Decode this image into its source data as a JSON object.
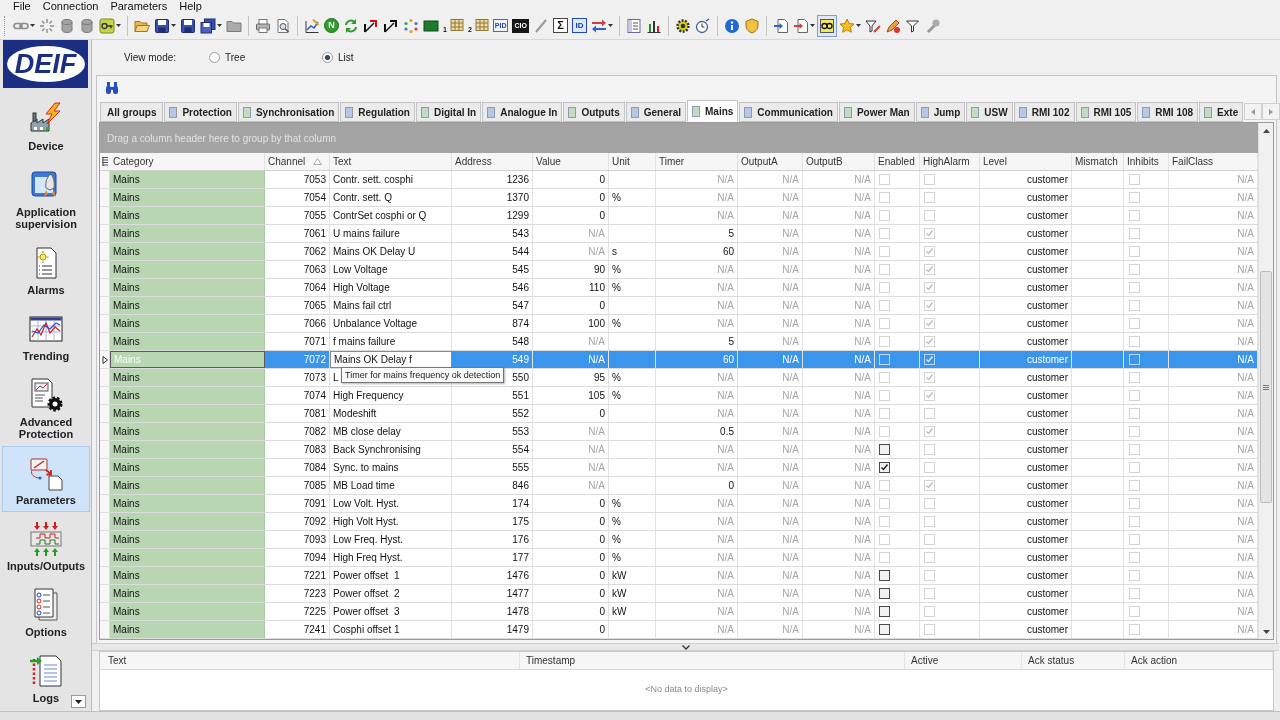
{
  "menu": [
    "File",
    "Connection",
    "Parameters",
    "Help"
  ],
  "toolbar": [
    {
      "pressed": false
    },
    {
      "pressed": false
    },
    {
      "pressed": false
    },
    {
      "pressed": false
    },
    {
      "pressed": false
    },
    {
      "pressed": false
    },
    {
      "pressed": false
    },
    {
      "pressed": false
    },
    {
      "pressed": false
    },
    {
      "pressed": false
    },
    {
      "pressed": false
    },
    {
      "pressed": false
    },
    {
      "pressed": false
    },
    {
      "pressed": false,
      "label": "N"
    },
    {
      "pressed": false
    },
    {
      "pressed": false
    },
    {
      "pressed": false
    },
    {
      "pressed": false
    },
    {
      "pressed": false
    },
    {
      "pressed": false,
      "label": "1"
    },
    {
      "pressed": false,
      "label": "2"
    },
    {
      "pressed": false,
      "label": "PID"
    },
    {
      "pressed": false,
      "label": "CIO"
    },
    {
      "pressed": false
    },
    {
      "pressed": false,
      "label": "Σ"
    },
    {
      "pressed": false,
      "label": "ID"
    },
    {
      "pressed": false
    },
    {
      "pressed": false
    },
    {
      "pressed": false
    },
    {
      "pressed": false
    },
    {
      "pressed": false
    },
    {
      "pressed": false
    },
    {
      "pressed": false
    },
    {
      "pressed": false
    },
    {
      "pressed": false
    },
    {
      "pressed": true
    },
    {
      "pressed": false
    },
    {
      "pressed": false
    },
    {
      "pressed": false
    },
    {
      "pressed": false
    },
    {
      "pressed": false
    }
  ],
  "logo": "DEIF",
  "sidebar": {
    "items": [
      {
        "label": "Device",
        "selected": false
      },
      {
        "label": "Application supervision",
        "selected": false
      },
      {
        "label": "Alarms",
        "selected": false
      },
      {
        "label": "Trending",
        "selected": false
      },
      {
        "label": "Advanced Protection",
        "selected": false
      },
      {
        "label": "Parameters",
        "selected": true
      },
      {
        "label": "Inputs/Outputs",
        "selected": false
      },
      {
        "label": "Options",
        "selected": false
      },
      {
        "label": "Logs",
        "selected": false
      }
    ]
  },
  "view_mode": {
    "label": "View mode:",
    "options": [
      {
        "label": "Tree",
        "selected": false
      },
      {
        "label": "List",
        "selected": true
      }
    ]
  },
  "tabs": [
    {
      "label": "All groups",
      "selected": false
    },
    {
      "label": "Protection",
      "selected": false,
      "color": "#b7c8e6"
    },
    {
      "label": "Synchronisation",
      "selected": false,
      "color": "#c3dbbf"
    },
    {
      "label": "Regulation",
      "selected": false,
      "color": "#b7c8e6"
    },
    {
      "label": "Digital In",
      "selected": false,
      "color": "#c3dbbf"
    },
    {
      "label": "Analogue In",
      "selected": false,
      "color": "#b7c8e6"
    },
    {
      "label": "Outputs",
      "selected": false,
      "color": "#c3dbbf"
    },
    {
      "label": "General",
      "selected": false,
      "color": "#b7c8e6"
    },
    {
      "label": "Mains",
      "selected": true,
      "color": "#c3dbbf"
    },
    {
      "label": "Communication",
      "selected": false,
      "color": "#b7c8e6"
    },
    {
      "label": "Power Man",
      "selected": false,
      "color": "#c3dbbf"
    },
    {
      "label": "Jump",
      "selected": false,
      "color": "#b7c8e6"
    },
    {
      "label": "USW",
      "selected": false,
      "color": "#c3dbbf"
    },
    {
      "label": "RMI 102",
      "selected": false,
      "color": "#b7c8e6"
    },
    {
      "label": "RMI 105",
      "selected": false,
      "color": "#c3dbbf"
    },
    {
      "label": "RMI 108",
      "selected": false,
      "color": "#b7c8e6"
    },
    {
      "label": "Exte",
      "selected": false,
      "color": "#c3dbbf"
    }
  ],
  "table": {
    "group_by_hint": "Drag a column header here to group by that column",
    "columns": [
      {
        "label": "Category",
        "sorted": false
      },
      {
        "label": "Channel",
        "sorted": true
      },
      {
        "label": "Text",
        "sorted": false
      },
      {
        "label": "Address",
        "sorted": false
      },
      {
        "label": "Value",
        "sorted": false
      },
      {
        "label": "Unit",
        "sorted": false
      },
      {
        "label": "Timer",
        "sorted": false
      },
      {
        "label": "OutputA",
        "sorted": false
      },
      {
        "label": "OutputB",
        "sorted": false
      },
      {
        "label": "Enabled",
        "sorted": false
      },
      {
        "label": "HighAlarm",
        "sorted": false
      },
      {
        "label": "Level",
        "sorted": false
      },
      {
        "label": "Mismatch",
        "sorted": false
      },
      {
        "label": "Inhibits",
        "sorted": false
      },
      {
        "label": "FailClass",
        "sorted": false
      }
    ],
    "rows": [
      {
        "selected": false,
        "category": "Mains",
        "channel": "7053",
        "text": "Contr. sett. cosphi",
        "address": "1236",
        "value": "0",
        "value_dimmed": false,
        "timer": "N/A",
        "timer_dimmed": true,
        "output_a": "N/A",
        "output_b": "N/A",
        "enabled": {
          "checked": false,
          "disabled": true
        },
        "high_alarm": false,
        "access_level": "customer",
        "inhibits": false,
        "fail_class": "N/A"
      },
      {
        "selected": false,
        "category": "Mains",
        "channel": "7054",
        "text": "Contr. sett. Q",
        "address": "1370",
        "value": "0",
        "value_dimmed": false,
        "unit": "%",
        "timer": "N/A",
        "timer_dimmed": true,
        "output_a": "N/A",
        "output_b": "N/A",
        "enabled": {
          "checked": false,
          "disabled": true
        },
        "high_alarm": false,
        "access_level": "customer",
        "inhibits": false,
        "fail_class": "N/A"
      },
      {
        "selected": false,
        "category": "Mains",
        "channel": "7055",
        "text": "ContrSet cosphi or Q",
        "address": "1299",
        "value": "0",
        "value_dimmed": false,
        "timer": "N/A",
        "timer_dimmed": true,
        "output_a": "N/A",
        "output_b": "N/A",
        "enabled": {
          "checked": false,
          "disabled": true
        },
        "high_alarm": false,
        "access_level": "customer",
        "inhibits": false,
        "fail_class": "N/A"
      },
      {
        "selected": false,
        "category": "Mains",
        "channel": "7061",
        "text": "U mains failure",
        "address": "543",
        "value": "N/A",
        "value_dimmed": true,
        "timer": "5",
        "timer_dimmed": false,
        "output_a": "N/A",
        "output_b": "N/A",
        "enabled": {
          "checked": false,
          "disabled": true
        },
        "high_alarm": true,
        "access_level": "customer",
        "inhibits": false,
        "fail_class": "N/A"
      },
      {
        "selected": false,
        "category": "Mains",
        "channel": "7062",
        "text": "Mains OK Delay U",
        "address": "544",
        "value": "N/A",
        "value_dimmed": true,
        "unit": "s",
        "timer": "60",
        "timer_dimmed": false,
        "output_a": "N/A",
        "output_b": "N/A",
        "enabled": {
          "checked": false,
          "disabled": true
        },
        "high_alarm": true,
        "access_level": "customer",
        "inhibits": false,
        "fail_class": "N/A"
      },
      {
        "selected": false,
        "category": "Mains",
        "channel": "7063",
        "text": "Low Voltage",
        "address": "545",
        "value": "90",
        "value_dimmed": false,
        "unit": "%",
        "timer": "N/A",
        "timer_dimmed": true,
        "output_a": "N/A",
        "output_b": "N/A",
        "enabled": {
          "checked": false,
          "disabled": true
        },
        "high_alarm": true,
        "access_level": "customer",
        "inhibits": false,
        "fail_class": "N/A"
      },
      {
        "selected": false,
        "category": "Mains",
        "channel": "7064",
        "text": "High Voltage",
        "address": "546",
        "value": "110",
        "value_dimmed": false,
        "unit": "%",
        "timer": "N/A",
        "timer_dimmed": true,
        "output_a": "N/A",
        "output_b": "N/A",
        "enabled": {
          "checked": false,
          "disabled": true
        },
        "high_alarm": true,
        "access_level": "customer",
        "inhibits": false,
        "fail_class": "N/A"
      },
      {
        "selected": false,
        "category": "Mains",
        "channel": "7065",
        "text": "Mains fail ctrl",
        "address": "547",
        "value": "0",
        "value_dimmed": false,
        "timer": "N/A",
        "timer_dimmed": true,
        "output_a": "N/A",
        "output_b": "N/A",
        "enabled": {
          "checked": false,
          "disabled": true
        },
        "high_alarm": true,
        "access_level": "customer",
        "inhibits": false,
        "fail_class": "N/A"
      },
      {
        "selected": false,
        "category": "Mains",
        "channel": "7066",
        "text": "Unbalance Voltage",
        "address": "874",
        "value": "100",
        "value_dimmed": false,
        "unit": "%",
        "timer": "N/A",
        "timer_dimmed": true,
        "output_a": "N/A",
        "output_b": "N/A",
        "enabled": {
          "checked": false,
          "disabled": true
        },
        "high_alarm": true,
        "access_level": "customer",
        "inhibits": false,
        "fail_class": "N/A"
      },
      {
        "selected": false,
        "category": "Mains",
        "channel": "7071",
        "text": "f mains failure",
        "address": "548",
        "value": "N/A",
        "value_dimmed": true,
        "timer": "5",
        "timer_dimmed": false,
        "output_a": "N/A",
        "output_b": "N/A",
        "enabled": {
          "checked": false,
          "disabled": true
        },
        "high_alarm": true,
        "access_level": "customer",
        "inhibits": false,
        "fail_class": "N/A"
      },
      {
        "selected": true,
        "category": "Mains",
        "channel": "7072",
        "text": "Mains OK Delay f",
        "address": "549",
        "value": "N/A",
        "value_dimmed": true,
        "timer": "60",
        "timer_dimmed": false,
        "output_a": "N/A",
        "output_b": "N/A",
        "enabled": {
          "checked": false,
          "disabled": true
        },
        "high_alarm": true,
        "access_level": "customer",
        "inhibits": false,
        "fail_class": "N/A"
      },
      {
        "selected": false,
        "category": "Mains",
        "channel": "7073",
        "text": "L",
        "address": "550",
        "value": "95",
        "value_dimmed": false,
        "unit": "%",
        "timer": "N/A",
        "timer_dimmed": true,
        "output_a": "N/A",
        "output_b": "N/A",
        "enabled": {
          "checked": false,
          "disabled": true
        },
        "high_alarm": true,
        "access_level": "customer",
        "inhibits": false,
        "fail_class": "N/A"
      },
      {
        "selected": false,
        "category": "Mains",
        "channel": "7074",
        "text": "High Frequency",
        "address": "551",
        "value": "105",
        "value_dimmed": false,
        "unit": "%",
        "timer": "N/A",
        "timer_dimmed": true,
        "output_a": "N/A",
        "output_b": "N/A",
        "enabled": {
          "checked": false,
          "disabled": true
        },
        "high_alarm": true,
        "access_level": "customer",
        "inhibits": false,
        "fail_class": "N/A"
      },
      {
        "selected": false,
        "category": "Mains",
        "channel": "7081",
        "text": "Modeshift",
        "address": "552",
        "value": "0",
        "value_dimmed": false,
        "timer": "N/A",
        "timer_dimmed": true,
        "output_a": "N/A",
        "output_b": "N/A",
        "enabled": {
          "checked": false,
          "disabled": true
        },
        "high_alarm": false,
        "access_level": "customer",
        "inhibits": false,
        "fail_class": "N/A"
      },
      {
        "selected": false,
        "category": "Mains",
        "channel": "7082",
        "text": "MB close delay",
        "address": "553",
        "value": "N/A",
        "value_dimmed": true,
        "timer": "0.5",
        "timer_dimmed": false,
        "output_a": "N/A",
        "output_b": "N/A",
        "enabled": {
          "checked": false,
          "disabled": true
        },
        "high_alarm": true,
        "access_level": "customer",
        "inhibits": false,
        "fail_class": "N/A"
      },
      {
        "selected": false,
        "category": "Mains",
        "channel": "7083",
        "text": "Back Synchronising",
        "address": "554",
        "value": "N/A",
        "value_dimmed": true,
        "timer": "N/A",
        "timer_dimmed": true,
        "output_a": "N/A",
        "output_b": "N/A",
        "enabled": {
          "checked": false,
          "disabled": false
        },
        "high_alarm": false,
        "access_level": "customer",
        "inhibits": false,
        "fail_class": "N/A"
      },
      {
        "selected": false,
        "category": "Mains",
        "channel": "7084",
        "text": "Sync. to mains",
        "address": "555",
        "value": "N/A",
        "value_dimmed": true,
        "timer": "N/A",
        "timer_dimmed": true,
        "output_a": "N/A",
        "output_b": "N/A",
        "enabled": {
          "checked": true,
          "disabled": false
        },
        "high_alarm": false,
        "access_level": "customer",
        "inhibits": false,
        "fail_class": "N/A"
      },
      {
        "selected": false,
        "category": "Mains",
        "channel": "7085",
        "text": "MB Load time",
        "address": "846",
        "value": "N/A",
        "value_dimmed": true,
        "timer": "0",
        "timer_dimmed": false,
        "output_a": "N/A",
        "output_b": "N/A",
        "enabled": {
          "checked": false,
          "disabled": true
        },
        "high_alarm": true,
        "access_level": "customer",
        "inhibits": false,
        "fail_class": "N/A"
      },
      {
        "selected": false,
        "category": "Mains",
        "channel": "7091",
        "text": "Low Volt. Hyst.",
        "address": "174",
        "value": "0",
        "value_dimmed": false,
        "unit": "%",
        "timer": "N/A",
        "timer_dimmed": true,
        "output_a": "N/A",
        "output_b": "N/A",
        "enabled": {
          "checked": false,
          "disabled": true
        },
        "high_alarm": false,
        "access_level": "customer",
        "inhibits": false,
        "fail_class": "N/A"
      },
      {
        "selected": false,
        "category": "Mains",
        "channel": "7092",
        "text": "High Volt Hyst.",
        "address": "175",
        "value": "0",
        "value_dimmed": false,
        "unit": "%",
        "timer": "N/A",
        "timer_dimmed": true,
        "output_a": "N/A",
        "output_b": "N/A",
        "enabled": {
          "checked": false,
          "disabled": true
        },
        "high_alarm": false,
        "access_level": "customer",
        "inhibits": false,
        "fail_class": "N/A"
      },
      {
        "selected": false,
        "category": "Mains",
        "channel": "7093",
        "text": "Low Freq. Hyst.",
        "address": "176",
        "value": "0",
        "value_dimmed": false,
        "unit": "%",
        "timer": "N/A",
        "timer_dimmed": true,
        "output_a": "N/A",
        "output_b": "N/A",
        "enabled": {
          "checked": false,
          "disabled": true
        },
        "high_alarm": false,
        "access_level": "customer",
        "inhibits": false,
        "fail_class": "N/A"
      },
      {
        "selected": false,
        "category": "Mains",
        "channel": "7094",
        "text": "High Freq Hyst.",
        "address": "177",
        "value": "0",
        "value_dimmed": false,
        "unit": "%",
        "timer": "N/A",
        "timer_dimmed": true,
        "output_a": "N/A",
        "output_b": "N/A",
        "enabled": {
          "checked": false,
          "disabled": true
        },
        "high_alarm": false,
        "access_level": "customer",
        "inhibits": false,
        "fail_class": "N/A"
      },
      {
        "selected": false,
        "category": "Mains",
        "channel": "7221",
        "text": "Power offset  1",
        "address": "1476",
        "value": "0",
        "value_dimmed": false,
        "unit": "kW",
        "timer": "N/A",
        "timer_dimmed": true,
        "output_a": "N/A",
        "output_b": "N/A",
        "enabled": {
          "checked": false,
          "disabled": false
        },
        "high_alarm": false,
        "access_level": "customer",
        "inhibits": false,
        "fail_class": "N/A"
      },
      {
        "selected": false,
        "category": "Mains",
        "channel": "7223",
        "text": "Power offset  2",
        "address": "1477",
        "value": "0",
        "value_dimmed": false,
        "unit": "kW",
        "timer": "N/A",
        "timer_dimmed": true,
        "output_a": "N/A",
        "output_b": "N/A",
        "enabled": {
          "checked": false,
          "disabled": false
        },
        "high_alarm": false,
        "access_level": "customer",
        "inhibits": false,
        "fail_class": "N/A"
      },
      {
        "selected": false,
        "category": "Mains",
        "channel": "7225",
        "text": "Power offset  3",
        "address": "1478",
        "value": "0",
        "value_dimmed": false,
        "unit": "kW",
        "timer": "N/A",
        "timer_dimmed": true,
        "output_a": "N/A",
        "output_b": "N/A",
        "enabled": {
          "checked": false,
          "disabled": false
        },
        "high_alarm": false,
        "access_level": "customer",
        "inhibits": false,
        "fail_class": "N/A"
      },
      {
        "selected": false,
        "category": "Mains",
        "channel": "7241",
        "text": "Cosphi offset 1",
        "address": "1479",
        "value": "0",
        "value_dimmed": false,
        "timer": "N/A",
        "timer_dimmed": true,
        "output_a": "N/A",
        "output_b": "N/A",
        "enabled": {
          "checked": false,
          "disabled": false
        },
        "high_alarm": false,
        "access_level": "customer",
        "inhibits": false,
        "fail_class": "N/A"
      }
    ],
    "tooltip": "Timer for mains frequency ok detection"
  },
  "alarm_list": {
    "columns": [
      "Text",
      "Timestamp",
      "Active",
      "Ack status",
      "Ack action"
    ],
    "empty_text": "<No data to display>"
  }
}
